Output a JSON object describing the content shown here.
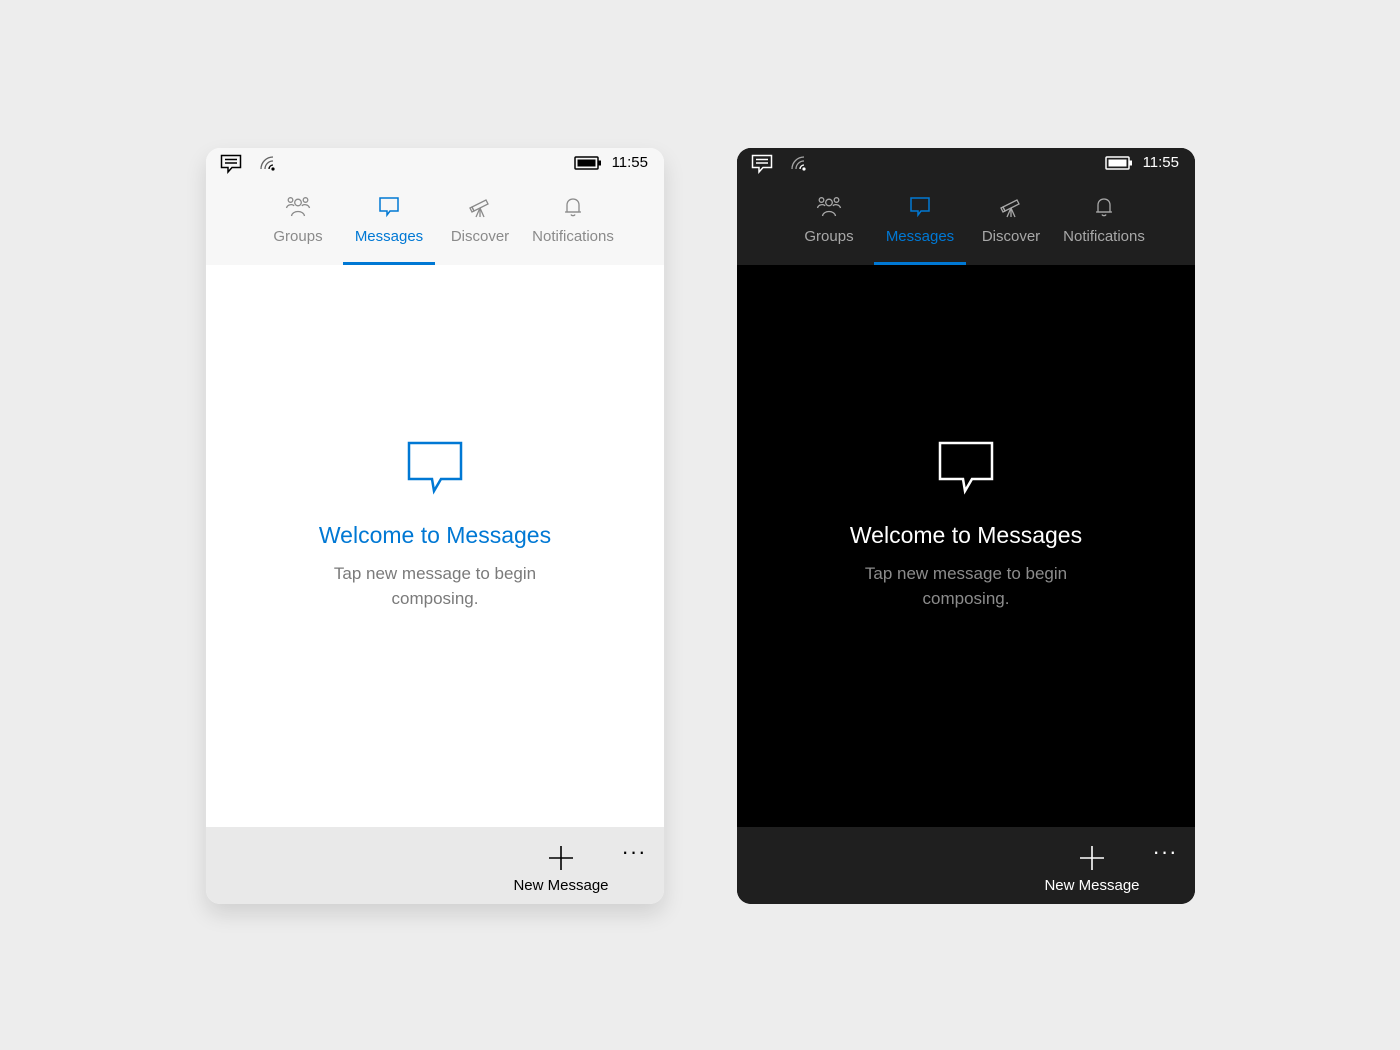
{
  "accent_color": "#0078d4",
  "light": {
    "status": {
      "time": "11:55",
      "icons": [
        "message-icon",
        "wifi-icon",
        "battery-icon"
      ]
    },
    "tabs": [
      {
        "label": "Groups",
        "icon": "groups-icon",
        "active": false
      },
      {
        "label": "Messages",
        "icon": "chat-bubble-icon",
        "active": true
      },
      {
        "label": "Discover",
        "icon": "telescope-icon",
        "active": false
      },
      {
        "label": "Notifications",
        "icon": "bell-icon",
        "active": false
      }
    ],
    "welcome": {
      "icon": "chat-bubble-icon",
      "title": "Welcome to Messages",
      "subtitle": "Tap new message to begin composing."
    },
    "appbar": {
      "new_message_label": "New Message",
      "new_message_icon": "plus-icon",
      "more_label": "···"
    }
  },
  "dark": {
    "status": {
      "time": "11:55",
      "icons": [
        "message-icon",
        "wifi-icon",
        "battery-icon"
      ]
    },
    "tabs": [
      {
        "label": "Groups",
        "icon": "groups-icon",
        "active": false
      },
      {
        "label": "Messages",
        "icon": "chat-bubble-icon",
        "active": true
      },
      {
        "label": "Discover",
        "icon": "telescope-icon",
        "active": false
      },
      {
        "label": "Notifications",
        "icon": "bell-icon",
        "active": false
      }
    ],
    "welcome": {
      "icon": "chat-bubble-icon",
      "title": "Welcome to Messages",
      "subtitle": "Tap new message to begin composing."
    },
    "appbar": {
      "new_message_label": "New Message",
      "new_message_icon": "plus-icon",
      "more_label": "···"
    }
  }
}
